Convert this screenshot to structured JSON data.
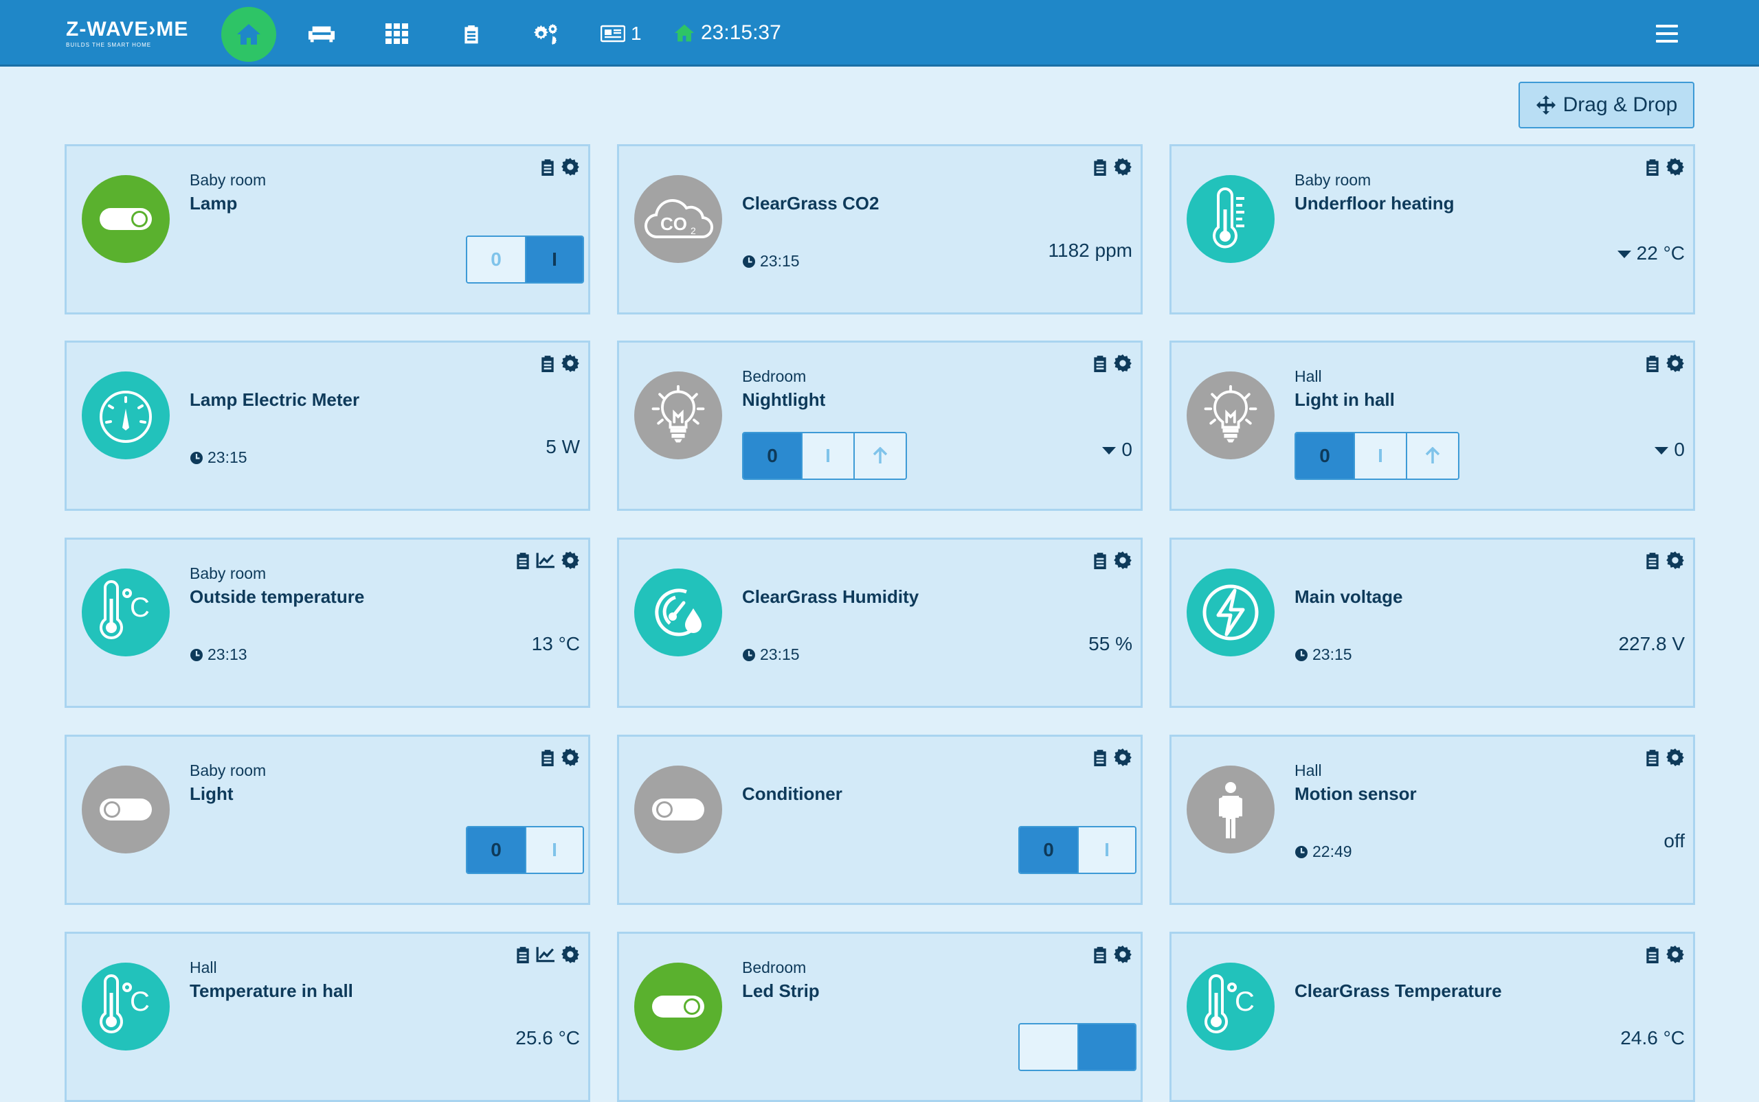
{
  "header": {
    "logo_main": "Z-WAVE›ME",
    "logo_sub": "BUILDS THE SMART HOME",
    "notification_count": "1",
    "clock": "23:15:37"
  },
  "toolbar": {
    "drag_drop_label": "Drag & Drop"
  },
  "colors": {
    "topbar": "#1f87c8",
    "active_nav": "#2ec466",
    "teal": "#22c2bb",
    "green": "#5ab12e",
    "grey": "#a3a3a3"
  },
  "cards": [
    {
      "room": "Baby room",
      "title": "Lamp",
      "icon": "toggle-on-icon",
      "switch": {
        "off_label": "0",
        "on_label": "I",
        "state": "on"
      }
    },
    {
      "title": "ClearGrass CO2",
      "icon": "co2-cloud-icon",
      "time": "23:15",
      "value": "1182 ppm"
    },
    {
      "room": "Baby room",
      "title": "Underfloor heating",
      "icon": "thermometer-icon",
      "value": "22 °C"
    },
    {
      "title": "Lamp Electric Meter",
      "icon": "meter-gauge-icon",
      "time": "23:15",
      "value": "5 W"
    },
    {
      "room": "Bedroom",
      "title": "Nightlight",
      "icon": "bulb-icon",
      "dimmer": {
        "off_label": "0",
        "on_label": "I",
        "state": "off"
      },
      "value": "0"
    },
    {
      "room": "Hall",
      "title": "Light in hall",
      "icon": "bulb-icon",
      "dimmer": {
        "off_label": "0",
        "on_label": "I",
        "state": "off"
      },
      "value": "0"
    },
    {
      "room": "Baby room",
      "title": "Outside temperature",
      "icon": "temperature-celsius-icon",
      "time": "23:13",
      "value": "13 °C"
    },
    {
      "title": "ClearGrass Humidity",
      "icon": "humidity-icon",
      "time": "23:15",
      "value": "55 %"
    },
    {
      "title": "Main voltage",
      "icon": "lightning-icon",
      "time": "23:15",
      "value": "227.8 V"
    },
    {
      "room": "Baby room",
      "title": "Light",
      "icon": "toggle-off-icon",
      "switch": {
        "off_label": "0",
        "on_label": "I",
        "state": "off"
      }
    },
    {
      "title": "Conditioner",
      "icon": "toggle-off-icon",
      "switch": {
        "off_label": "0",
        "on_label": "I",
        "state": "off"
      }
    },
    {
      "room": "Hall",
      "title": "Motion sensor",
      "icon": "person-icon",
      "time": "22:49",
      "value": "off"
    },
    {
      "room": "Hall",
      "title": "Temperature in hall",
      "icon": "temperature-celsius-icon",
      "value": "25.6 °C"
    },
    {
      "room": "Bedroom",
      "title": "Led Strip",
      "icon": "toggle-on-icon"
    },
    {
      "title": "ClearGrass Temperature",
      "icon": "temperature-celsius-icon",
      "value": "24.6 °C"
    }
  ]
}
